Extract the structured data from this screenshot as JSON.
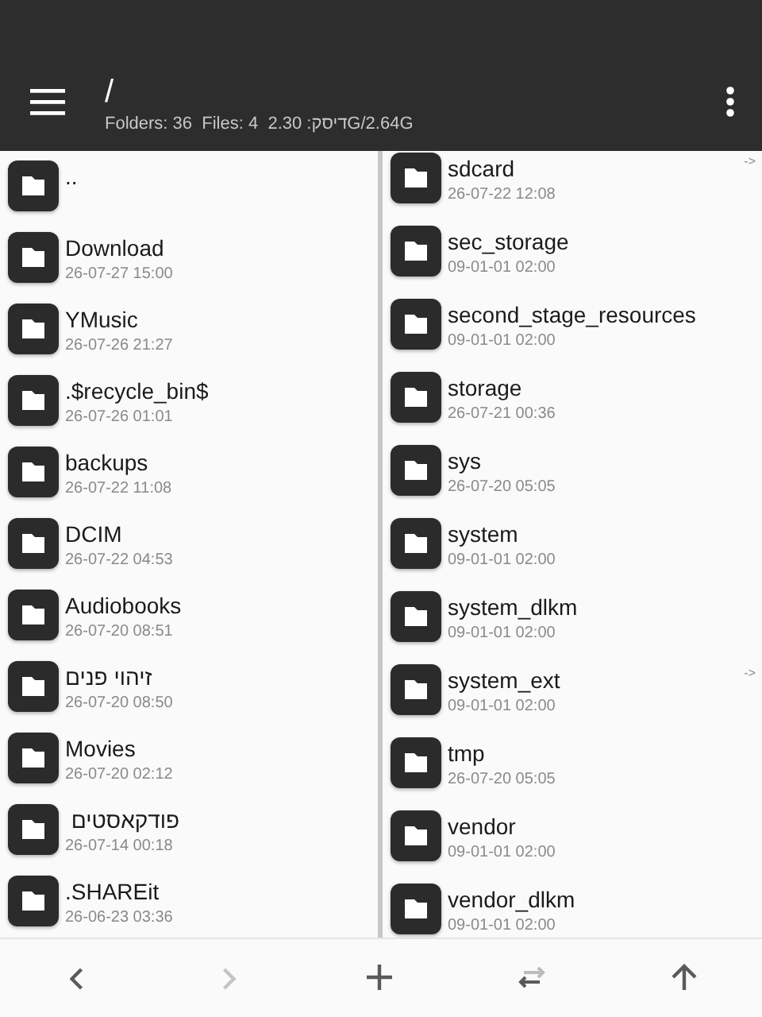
{
  "header": {
    "title": "/",
    "subtitle": "Folders: 36  Files: 4  2.30 :דיסקG/2.64G"
  },
  "left_pane": {
    "items": [
      {
        "name": ".."
      },
      {
        "name": "Download",
        "date": "26-07-27 15:00"
      },
      {
        "name": "YMusic",
        "date": "26-07-26 21:27"
      },
      {
        "name": ".$recycle_bin$",
        "date": "26-07-26 01:01"
      },
      {
        "name": "backups",
        "date": "26-07-22 11:08"
      },
      {
        "name": "DCIM",
        "date": "26-07-22 04:53"
      },
      {
        "name": "Audiobooks",
        "date": "26-07-20 08:51"
      },
      {
        "name": "זיהוי פנים",
        "date": "26-07-20 08:50"
      },
      {
        "name": "Movies",
        "date": "26-07-20 02:12"
      },
      {
        "name": " פודקאסטים",
        "date": "26-07-14 00:18"
      },
      {
        "name": ".SHAREit",
        "date": "26-06-23 03:36"
      }
    ]
  },
  "right_pane": {
    "items": [
      {
        "name": "sdcard",
        "date": "26-07-22 12:08",
        "link_marker": "->"
      },
      {
        "name": "sec_storage",
        "date": "09-01-01 02:00"
      },
      {
        "name": "second_stage_resources",
        "date": "09-01-01 02:00"
      },
      {
        "name": "storage",
        "date": "26-07-21 00:36"
      },
      {
        "name": "sys",
        "date": "26-07-20 05:05"
      },
      {
        "name": "system",
        "date": "09-01-01 02:00"
      },
      {
        "name": "system_dlkm",
        "date": "09-01-01 02:00"
      },
      {
        "name": "system_ext",
        "date": "09-01-01 02:00",
        "link_marker": "->"
      },
      {
        "name": "tmp",
        "date": "26-07-20 05:05"
      },
      {
        "name": "vendor",
        "date": "09-01-01 02:00"
      },
      {
        "name": "vendor_dlkm",
        "date": "09-01-01 02:00"
      }
    ]
  },
  "toolbar": [
    {
      "kind": "back",
      "disabled": false
    },
    {
      "kind": "forward",
      "disabled": true
    },
    {
      "kind": "add",
      "disabled": false
    },
    {
      "kind": "swap",
      "disabled": false
    },
    {
      "kind": "up",
      "disabled": false
    }
  ]
}
